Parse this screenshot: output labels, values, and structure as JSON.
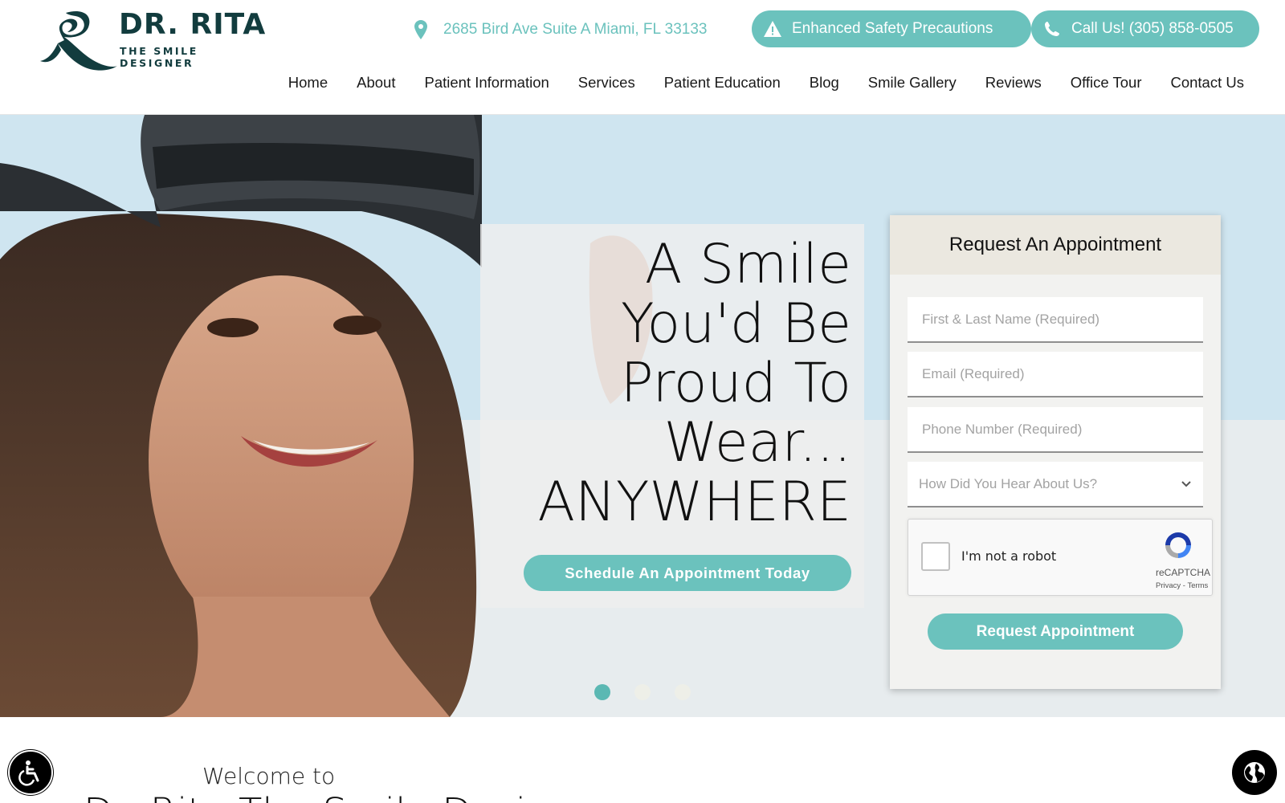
{
  "brand": {
    "name": "DR. RITA",
    "tagline": "THE SMILE DESIGNER"
  },
  "topbar": {
    "address": "2685 Bird Ave Suite A Miami, FL 33133",
    "safety_label": "Enhanced Safety Precautions",
    "call_label": "Call Us! (305) 858-0505"
  },
  "nav": {
    "items": [
      {
        "label": "Home"
      },
      {
        "label": "About"
      },
      {
        "label": "Patient Information"
      },
      {
        "label": "Services"
      },
      {
        "label": "Patient Education"
      },
      {
        "label": "Blog"
      },
      {
        "label": "Smile Gallery"
      },
      {
        "label": "Reviews"
      },
      {
        "label": "Office Tour"
      },
      {
        "label": "Contact Us"
      }
    ]
  },
  "hero": {
    "headline_lines": [
      "A Smile",
      "You'd Be",
      "Proud To",
      "Wear...",
      "ANYWHERE"
    ],
    "cta_label": "Schedule An Appointment Today",
    "slides": 3,
    "active_slide": 1
  },
  "appointment_form": {
    "title": "Request An Appointment",
    "fields": {
      "name_placeholder": "First & Last Name (Required)",
      "email_placeholder": "Email (Required)",
      "phone_placeholder": "Phone Number (Required)",
      "source_selected": "How Did You Hear About Us?"
    },
    "captcha": {
      "label": "I'm not a robot",
      "brand": "reCAPTCHA",
      "privacy": "Privacy",
      "separator": " - ",
      "terms": "Terms"
    },
    "submit_label": "Request Appointment"
  },
  "welcome": {
    "intro": "Welcome to",
    "title": "Dr. Rita The Smile Designer"
  },
  "colors": {
    "accent": "#6bc2bd",
    "brand_dark": "#123c3e"
  },
  "icons": [
    "map-pin-icon",
    "warning-icon",
    "phone-icon",
    "chevron-down-icon",
    "recaptcha-icon",
    "accessibility-icon",
    "globe-icon"
  ]
}
